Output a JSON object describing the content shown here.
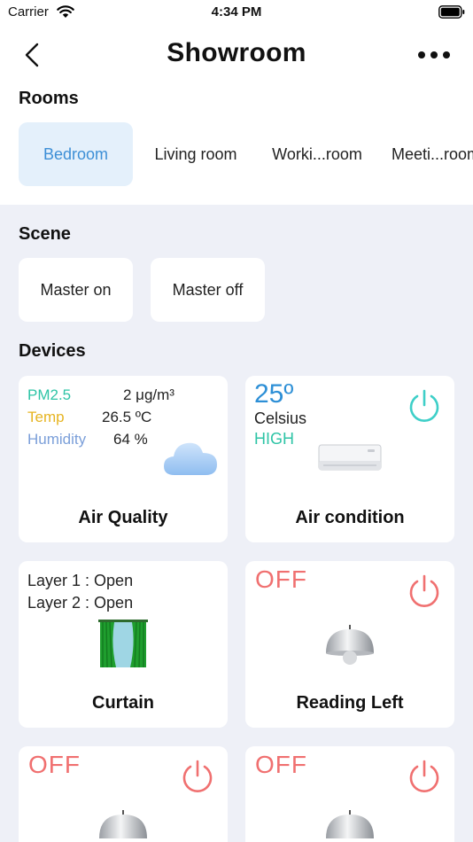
{
  "status_bar": {
    "carrier": "Carrier",
    "time": "4:34 PM"
  },
  "header": {
    "title": "Showroom"
  },
  "rooms": {
    "label": "Rooms",
    "tabs": [
      {
        "label": "Bedroom",
        "active": true
      },
      {
        "label": "Living room"
      },
      {
        "label": "Worki...room"
      },
      {
        "label": "Meeti...room"
      }
    ]
  },
  "scene": {
    "label": "Scene",
    "buttons": [
      {
        "label": "Master on"
      },
      {
        "label": "Master off"
      }
    ]
  },
  "devices": {
    "label": "Devices",
    "air_quality": {
      "name": "Air Quality",
      "rows": [
        {
          "label": "PM2.5",
          "value": "2 μg/m³",
          "color": "#2ec4a6"
        },
        {
          "label": "Temp",
          "value": "26.5 ºC",
          "color": "#e6b422"
        },
        {
          "label": "Humidity",
          "value": "64 %",
          "color": "#7b9fd9"
        }
      ],
      "icon": "cloud-icon"
    },
    "air_condition": {
      "name": "Air condition",
      "temperature": "25º",
      "unit": "Celsius",
      "fan": "HIGH",
      "power_color": "#3ecfc8"
    },
    "curtain": {
      "name": "Curtain",
      "layer1": "Layer 1 : Open",
      "layer2": "Layer 2 : Open"
    },
    "reading_left": {
      "name": "Reading Left",
      "state": "OFF"
    },
    "lamp3": {
      "state": "OFF"
    },
    "lamp4": {
      "state": "OFF"
    },
    "off_color": "#f07070"
  }
}
